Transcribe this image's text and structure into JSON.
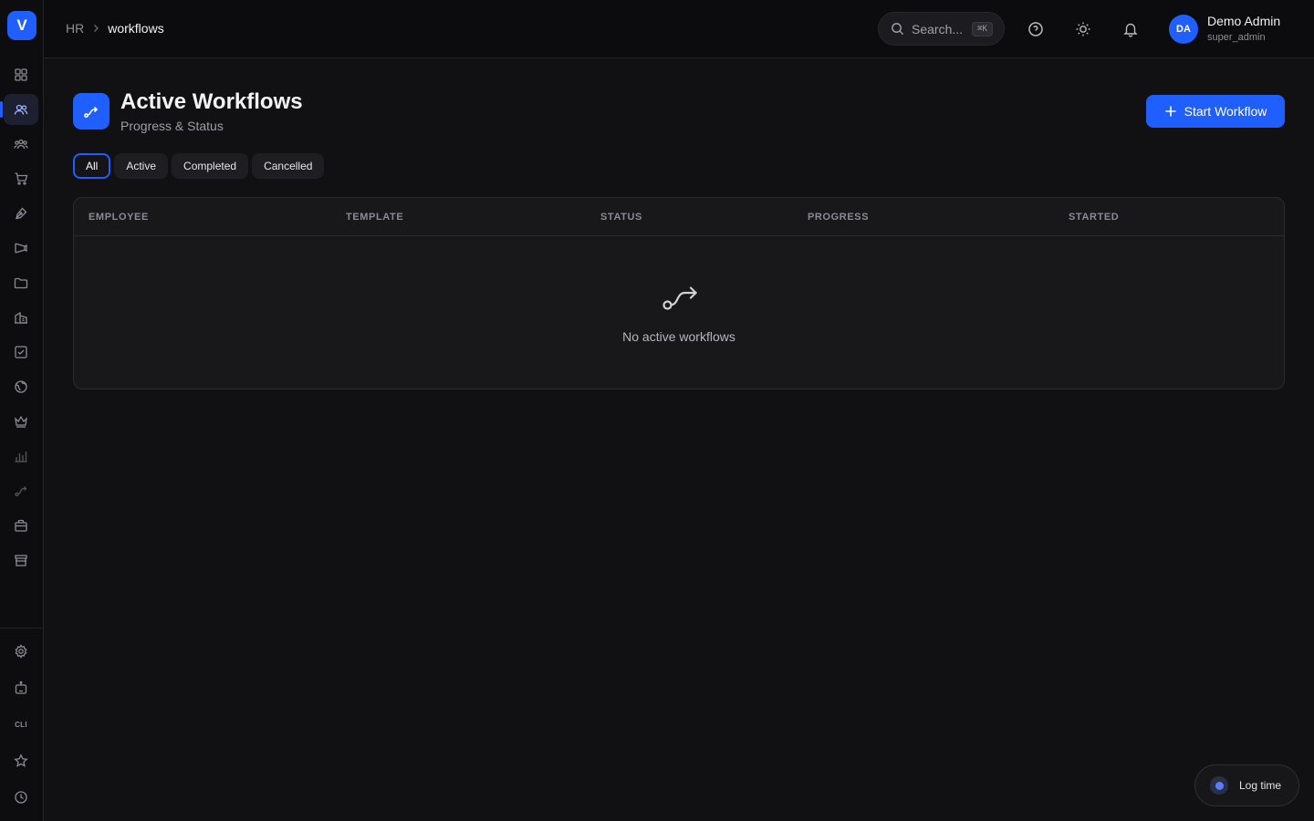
{
  "sidebar": {
    "logo": "V",
    "cli": "CLI"
  },
  "topbar": {
    "breadcrumb": {
      "parent": "HR",
      "current": "workflows"
    },
    "search": {
      "label": "Search...",
      "shortcut": "⌘K"
    },
    "user": {
      "initials": "DA",
      "name": "Demo Admin",
      "role": "super_admin"
    }
  },
  "page": {
    "title": "Active Workflows",
    "subtitle": "Progress & Status",
    "start_button": "Start Workflow"
  },
  "filters": [
    "All",
    "Active",
    "Completed",
    "Cancelled"
  ],
  "table": {
    "columns": [
      "EMPLOYEE",
      "TEMPLATE",
      "STATUS",
      "PROGRESS",
      "STARTED"
    ],
    "empty_text": "No active workflows"
  },
  "log_time": {
    "label": "Log time"
  },
  "colors": {
    "accent": "#1f5eff",
    "background": "#111113",
    "card": "#18181b"
  }
}
